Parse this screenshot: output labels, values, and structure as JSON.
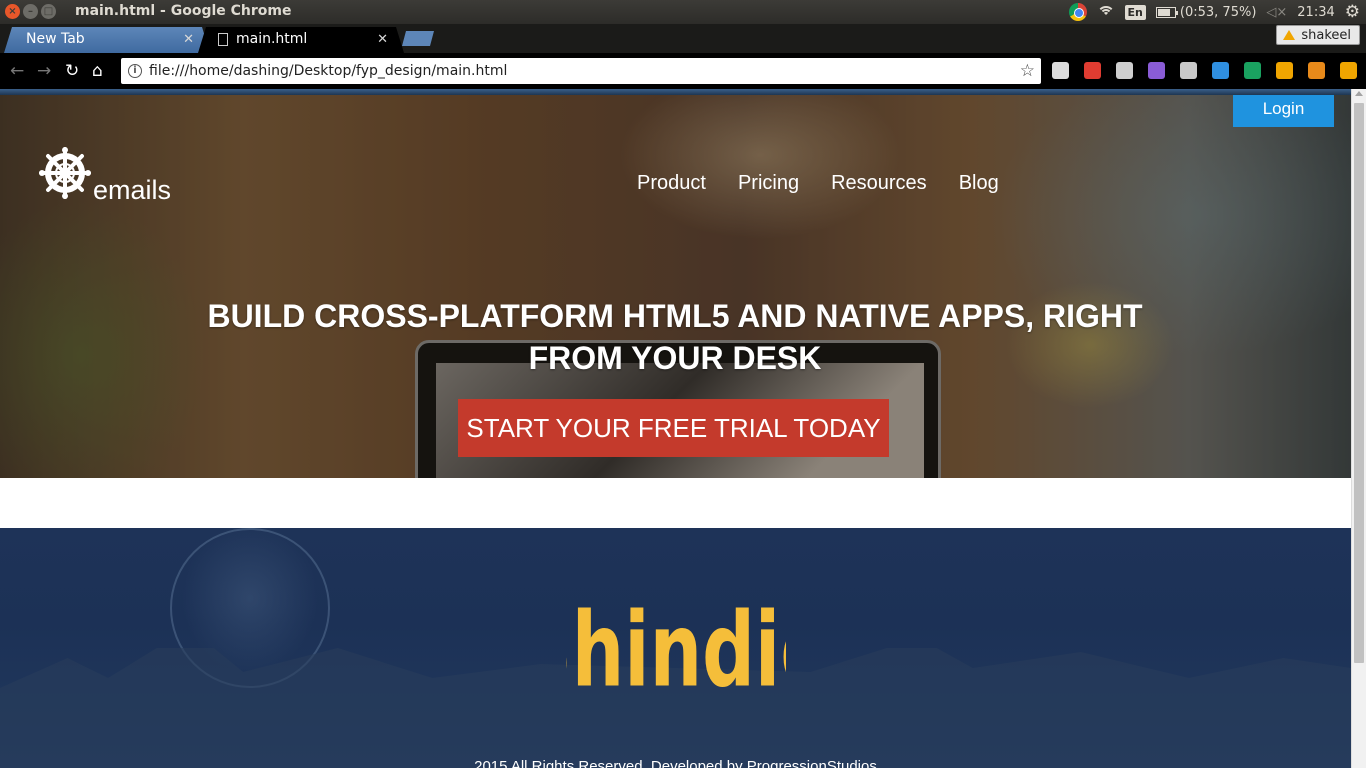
{
  "os": {
    "window_title": "main.html - Google Chrome",
    "keyboard_layout": "En",
    "battery": "(0:53, 75%)",
    "clock": "21:34"
  },
  "browser": {
    "tabs": [
      {
        "label": "New Tab",
        "active": false
      },
      {
        "label": "main.html",
        "active": true
      }
    ],
    "profile_name": "shakeel",
    "url": "file:///home/dashing/Desktop/fyp_design/main.html",
    "extensions": [
      {
        "name": "shield-ext-icon",
        "color": "#dddddd"
      },
      {
        "name": "adblock-ext-icon",
        "color": "#e03c31"
      },
      {
        "name": "planet-ext-icon",
        "color": "#cfcfcf"
      },
      {
        "name": "color-wheel-ext-icon",
        "color": "#8a5cd6"
      },
      {
        "name": "eyedropper-ext-icon",
        "color": "#c9c9c9"
      },
      {
        "name": "drop-ext-icon",
        "color": "#2f8fe0"
      },
      {
        "name": "flag-ext-icon",
        "color": "#1aa260"
      },
      {
        "name": "ruler-ext-icon",
        "color": "#f0a500"
      },
      {
        "name": "crop-ext-icon",
        "color": "#e88a1a"
      },
      {
        "name": "alert-ext-icon",
        "color": "#f0a500"
      }
    ]
  },
  "page": {
    "logo_text": "emails",
    "nav": [
      "Product",
      "Pricing",
      "Resources",
      "Blog"
    ],
    "login_label": "Login",
    "headline": "BUILD CROSS-PLATFORM HTML5 AND NATIVE APPS, RIGHT FROM YOUR DESK",
    "cta_label": "START YOUR FREE TRIAL TODAY",
    "footer_brand": "Shindig",
    "copyright": "2015 All Rights Reserved. Developed by ProgressionStudios",
    "colors": {
      "cta": "#c43a2c",
      "login": "#1f93df",
      "brand": "#f5be3a",
      "footer_bg": "#1e3358"
    }
  }
}
